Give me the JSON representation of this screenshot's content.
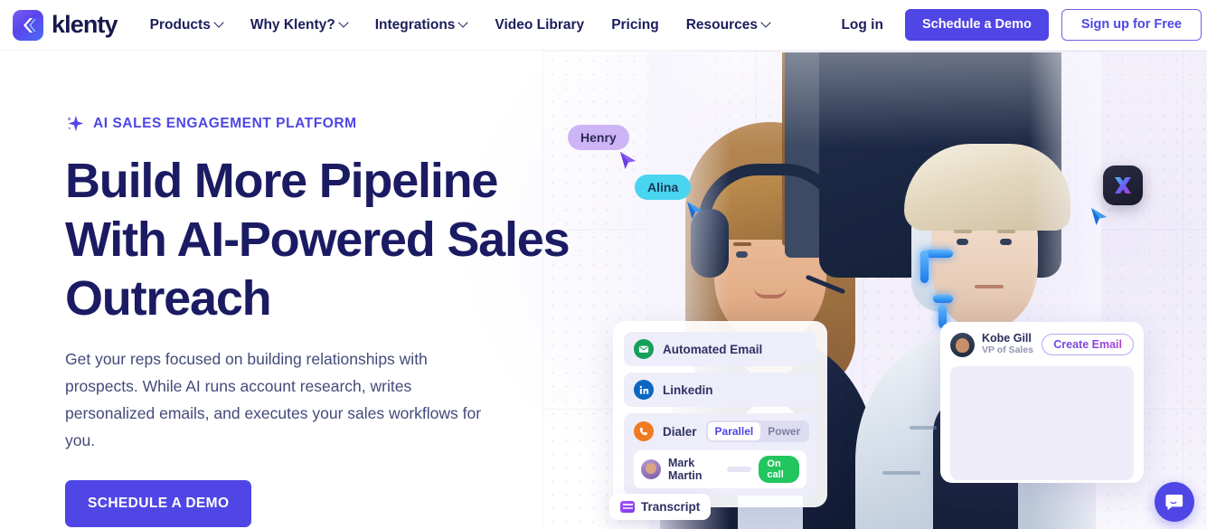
{
  "brand": {
    "name": "klenty",
    "logo_icon": "klenty-chevron-logo",
    "accent": "#4f46e5"
  },
  "nav": {
    "items": [
      {
        "label": "Products",
        "has_dropdown": true
      },
      {
        "label": "Why Klenty?",
        "has_dropdown": true
      },
      {
        "label": "Integrations",
        "has_dropdown": true
      },
      {
        "label": "Video Library",
        "has_dropdown": false
      },
      {
        "label": "Pricing",
        "has_dropdown": false
      },
      {
        "label": "Resources",
        "has_dropdown": true
      }
    ],
    "login_label": "Log in",
    "demo_label": "Schedule a Demo",
    "signup_label": "Sign up for Free"
  },
  "hero": {
    "eyebrow": "AI SALES ENGAGEMENT PLATFORM",
    "eyebrow_icon": "sparkle-icon",
    "title_line1": "Build More Pipeline",
    "title_line2": "With AI-Powered Sales",
    "title_line3": "Outreach",
    "subtitle": "Get your reps focused on building relationships with prospects. While AI runs account research, writes personalized emails, and executes your sales workflows for you.",
    "cta_label": "SCHEDULE A DEMO",
    "title_color": "#1b1b63",
    "chips": [
      {
        "label": "Henry",
        "color": "#cdb4f6",
        "cursor": "purple"
      },
      {
        "label": "Alina",
        "color": "#49d4f0",
        "cursor": "blue"
      }
    ],
    "x_badge_icon": "x-logo-icon"
  },
  "channels_card": {
    "rows": [
      {
        "label": "Automated Email",
        "icon": "email-icon",
        "icon_color": "#14a05a"
      },
      {
        "label": "Linkedin",
        "icon": "linkedin-icon",
        "icon_color": "#0a66c2"
      },
      {
        "label": "Dialer",
        "icon": "phone-icon",
        "icon_color": "#f07a20"
      }
    ],
    "dialer_modes": [
      {
        "label": "Parallel",
        "active": true
      },
      {
        "label": "Power",
        "active": false
      }
    ],
    "call": {
      "name": "Mark Martin",
      "status": "On call",
      "status_color": "#22c55e"
    }
  },
  "transcript": {
    "label": "Transcript",
    "icon": "transcript-icon"
  },
  "compose_card": {
    "name": "Kobe Gill",
    "role": "VP of Sales",
    "button_label": "Create Email"
  },
  "chat_widget": {
    "icon": "chat-bubble-icon",
    "color": "#4f46e5"
  }
}
